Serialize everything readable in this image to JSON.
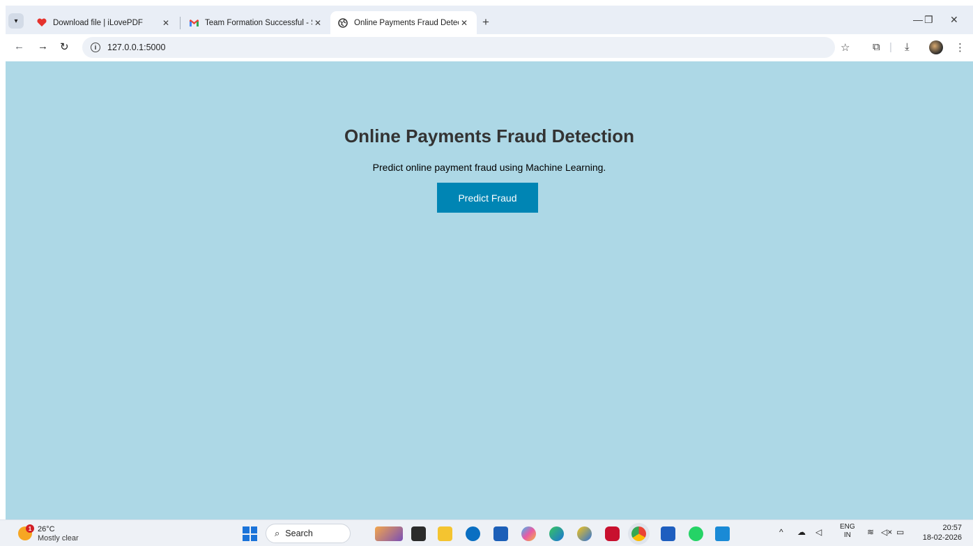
{
  "browser": {
    "tabs": [
      {
        "title": "Download file | iLovePDF",
        "favicon": "heart-icon",
        "active": false
      },
      {
        "title": "Team Formation Successful - Sm",
        "favicon": "gmail-icon",
        "active": false
      },
      {
        "title": "Online Payments Fraud Detectio",
        "favicon": "globe-icon",
        "active": true
      }
    ],
    "new_tab": "+",
    "address": "127.0.0.1:5000",
    "window_controls": {
      "minimize": "—",
      "restore": "❐",
      "close": "✕"
    }
  },
  "page": {
    "title": "Online Payments Fraud Detection",
    "subtitle": "Predict online payment fraud using Machine Learning.",
    "button_label": "Predict Fraud",
    "background": "#add8e6",
    "button_color": "#0085b4"
  },
  "taskbar": {
    "weather": {
      "badge": "1",
      "temp": "26°C",
      "condition": "Mostly clear"
    },
    "search_placeholder": "Search",
    "language": {
      "line1": "ENG",
      "line2": "IN"
    },
    "clock": {
      "time": "20:57",
      "date": "18-02-2026"
    }
  }
}
